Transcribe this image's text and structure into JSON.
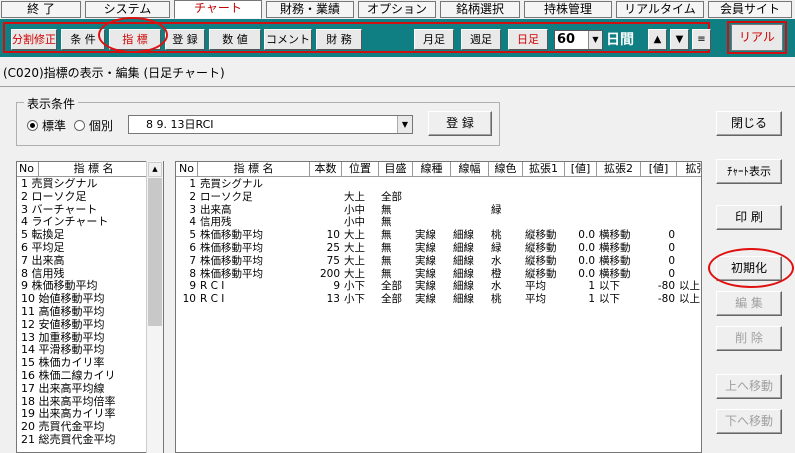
{
  "menu": {
    "tabs": [
      "終 了",
      "システム",
      "チャート",
      "財務・業績",
      "オプション",
      "銘柄選択",
      "持株管理",
      "リアルタイム",
      "会員サイト"
    ],
    "active_index": 2
  },
  "toolbar": {
    "buttons": [
      "分割修正",
      "条 件",
      "指 標",
      "登 録",
      "数 値",
      "コメント",
      "財 務"
    ],
    "period_buttons": [
      "月足",
      "週足",
      "日足"
    ],
    "count_value": "60",
    "count_unit": "日間",
    "up_label": "▲",
    "down_label": "▼",
    "menu_label": "≡",
    "real_label": "リアル"
  },
  "title": "(C020)指標の表示・編集 (日足チャート)",
  "conditions": {
    "legend": "表示条件",
    "radio_standard": "標準",
    "radio_individual": "個別",
    "selected": "standard",
    "select_value": "8 9. 13日RCI",
    "register_label": "登 録"
  },
  "left_list": {
    "col_no": "No",
    "col_name": "指 標 名",
    "items": [
      "1 売買シグナル",
      "2 ローソク足",
      "3 バーチャート",
      "4 ラインチャート",
      "5 転換足",
      "6 平均足",
      "7 出来高",
      "8 信用残",
      "9 株価移動平均",
      "10 始値移動平均",
      "11 高値移動平均",
      "12 安値移動平均",
      "13 加重移動平均",
      "14 平滑移動平均",
      "15 株価カイリ率",
      "16 株価二線カイリ",
      "17 出来高平均線",
      "18 出来高平均倍率",
      "19 出来高カイリ率",
      "20 売買代金平均",
      "21 総売買代金平均"
    ]
  },
  "main_table": {
    "headers": [
      "No",
      "指 標 名",
      "本数",
      "位置",
      "目盛",
      "線種",
      "線幅",
      "線色",
      "拡張1",
      "[値]",
      "拡張2",
      "[値]",
      "拡張"
    ],
    "rows": [
      [
        "1",
        "売買シグナル",
        "",
        "",
        "",
        "",
        "",
        "",
        "",
        "",
        "",
        "",
        ""
      ],
      [
        "2",
        "ローソク足",
        "",
        "大上",
        "全部",
        "",
        "",
        "",
        "",
        "",
        "",
        "",
        ""
      ],
      [
        "3",
        "出来高",
        "",
        "小中",
        "無",
        "",
        "",
        "緑",
        "",
        "",
        "",
        "",
        ""
      ],
      [
        "4",
        "信用残",
        "",
        "小中",
        "無",
        "",
        "",
        "",
        "",
        "",
        "",
        "",
        ""
      ],
      [
        "5",
        "株価移動平均",
        "10",
        "大上",
        "無",
        "実線",
        "細線",
        "桃",
        "縦移動",
        "0.0",
        "横移動",
        "0",
        ""
      ],
      [
        "6",
        "株価移動平均",
        "25",
        "大上",
        "無",
        "実線",
        "細線",
        "緑",
        "縦移動",
        "0.0",
        "横移動",
        "0",
        ""
      ],
      [
        "7",
        "株価移動平均",
        "75",
        "大上",
        "無",
        "実線",
        "細線",
        "水",
        "縦移動",
        "0.0",
        "横移動",
        "0",
        ""
      ],
      [
        "8",
        "株価移動平均",
        "200",
        "大上",
        "無",
        "実線",
        "細線",
        "橙",
        "縦移動",
        "0.0",
        "横移動",
        "0",
        ""
      ],
      [
        "9",
        "R C I",
        "9",
        "小下",
        "全部",
        "実線",
        "細線",
        "水",
        "平均",
        "1",
        "以下",
        "-80",
        "以上"
      ],
      [
        "10",
        "R C I",
        "13",
        "小下",
        "全部",
        "実線",
        "細線",
        "桃",
        "平均",
        "1",
        "以下",
        "-80",
        "以上"
      ]
    ]
  },
  "side_buttons": {
    "close": "閉じる",
    "chart_display": "ﾁｬｰﾄ表示",
    "print": "印 刷",
    "initialize": "初期化",
    "edit": "編 集",
    "delete": "削 除",
    "move_up": "上へ移動",
    "move_down": "下へ移動"
  },
  "colors": {
    "toolbar_teal": "#0f7f84",
    "highlight_red": "#e01010",
    "active_tab_text": "#c00000"
  }
}
